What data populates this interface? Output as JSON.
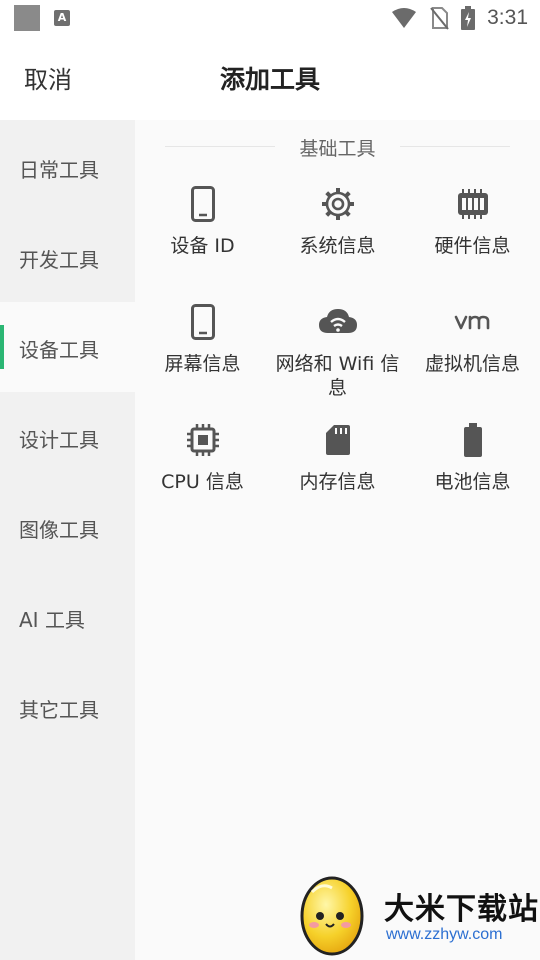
{
  "status_bar": {
    "time": "3:31",
    "notification_badge": "A"
  },
  "header": {
    "cancel_label": "取消",
    "title": "添加工具"
  },
  "sidebar": {
    "active_index": 2,
    "accent_color": "#2bb673",
    "items": [
      {
        "label": "日常工具"
      },
      {
        "label": "开发工具"
      },
      {
        "label": "设备工具"
      },
      {
        "label": "设计工具"
      },
      {
        "label": "图像工具"
      },
      {
        "label": "AI 工具"
      },
      {
        "label": "其它工具"
      }
    ]
  },
  "main": {
    "section_title": "基础工具",
    "tools": [
      {
        "label": "设备 ID",
        "icon": "phone-icon"
      },
      {
        "label": "系统信息",
        "icon": "gear-icon"
      },
      {
        "label": "硬件信息",
        "icon": "memory-chip-icon"
      },
      {
        "label": "屏幕信息",
        "icon": "phone-icon"
      },
      {
        "label": "网络和 Wifi 信息",
        "icon": "cloud-wifi-icon"
      },
      {
        "label": "虚拟机信息",
        "icon": "vm-icon"
      },
      {
        "label": "CPU 信息",
        "icon": "cpu-icon"
      },
      {
        "label": "内存信息",
        "icon": "sd-card-icon"
      },
      {
        "label": "电池信息",
        "icon": "battery-icon"
      }
    ]
  },
  "watermark": {
    "title": "大米下载站",
    "url": "www.zzhyw.com"
  }
}
